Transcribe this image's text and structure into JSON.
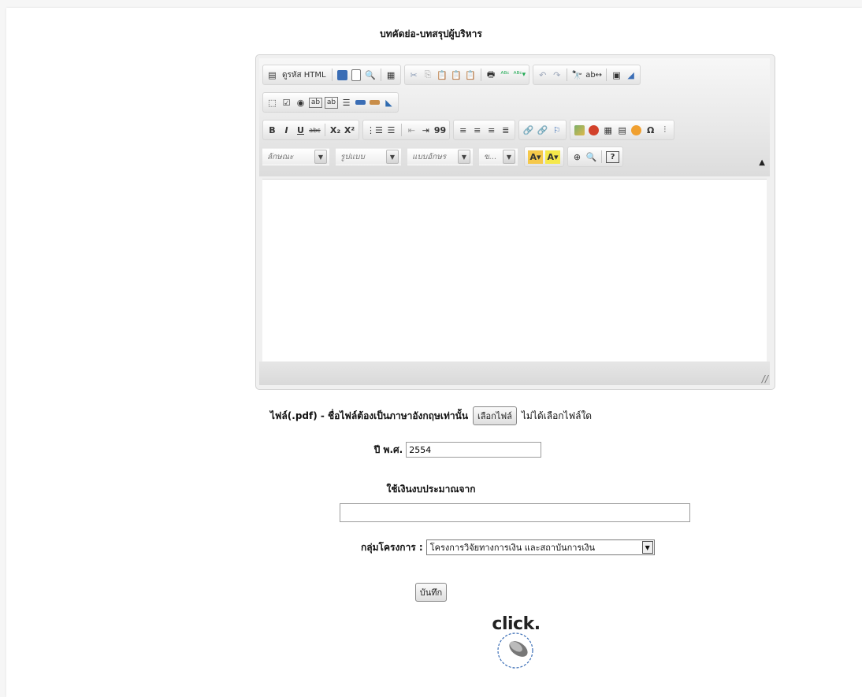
{
  "section_title": "บทคัดย่อ-บทสรุปผู้บริหาร",
  "editor": {
    "source_label": "ดูรหัส HTML",
    "combos": {
      "style": "ลักษณะ",
      "format": "รูปแบบ",
      "font": "แบบอักษร",
      "size": "ข..."
    },
    "row3": {
      "bold": "B",
      "italic": "I",
      "underline": "U",
      "strike": "abc",
      "subscript": "X₂",
      "superscript": "X²",
      "quote": "99",
      "omega": "Ω"
    },
    "help": "?"
  },
  "file_upload": {
    "label": "ไฟล์(.pdf) - ชื่อไฟล์ต้องเป็นภาษาอังกฤษเท่านั้น",
    "button": "เลือกไฟล์",
    "status": "ไม่ได้เลือกไฟล์ใด"
  },
  "year": {
    "label": "ปี พ.ศ.",
    "value": "2554"
  },
  "budget": {
    "label": "ใช้เงินงบประมาณจาก",
    "value": ""
  },
  "project_group": {
    "label": "กลุ่มโครงการ :",
    "selected": "โครงการวิจัยทางการเงิน และสถาบันการเงิน"
  },
  "save_button": "บันทึก",
  "click_logo_text": "click."
}
